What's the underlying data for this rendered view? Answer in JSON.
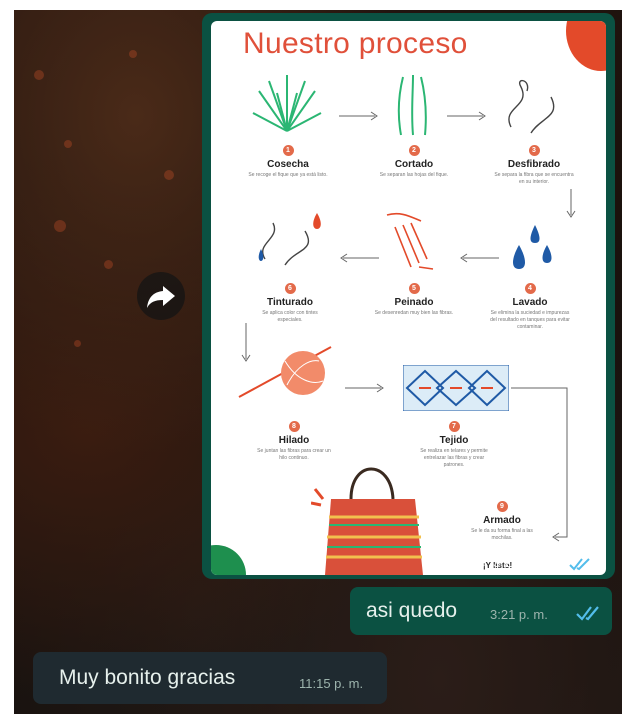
{
  "poster": {
    "title": "Nuestro proceso",
    "steps": [
      {
        "num": "1",
        "name": "Cosecha",
        "desc": "Se recoge el fique que ya está listo."
      },
      {
        "num": "2",
        "name": "Cortado",
        "desc": "Se separan las hojas del fique."
      },
      {
        "num": "3",
        "name": "Desfibrado",
        "desc": "Se separa la fibra que se encuentra en su interior."
      },
      {
        "num": "4",
        "name": "Lavado",
        "desc": "Se elimina la suciedad e impurezas del resultado en tanques para evitar contaminar."
      },
      {
        "num": "5",
        "name": "Peinado",
        "desc": "Se desenredan muy bien las fibras."
      },
      {
        "num": "6",
        "name": "Tinturado",
        "desc": "Se aplica color con tintes especiales."
      },
      {
        "num": "7",
        "name": "Tejido",
        "desc": "Se realiza en telares y permite entrelazar las fibras y crear patrones."
      },
      {
        "num": "8",
        "name": "Hilado",
        "desc": "Se juntan las fibras para crear un hilo continuo."
      },
      {
        "num": "9",
        "name": "Armado",
        "desc": "Se le da su forma final a las mochilas."
      }
    ],
    "final_text": "¡Y listo!"
  },
  "image_message": {
    "time": "3:21 p. m."
  },
  "outgoing_message": {
    "text": "asi quedo",
    "time": "3:21 p. m."
  },
  "incoming_message": {
    "text": "Muy bonito gracias",
    "time": "11:15 p. m."
  },
  "icons": {
    "forward": "forward-icon",
    "read_receipt": "double-check-icon"
  },
  "colors": {
    "outgoing_bubble": "#0b5142",
    "incoming_bubble": "#1f2a30",
    "read_tick": "#53bdeb",
    "poster_accent": "#e0503a"
  }
}
